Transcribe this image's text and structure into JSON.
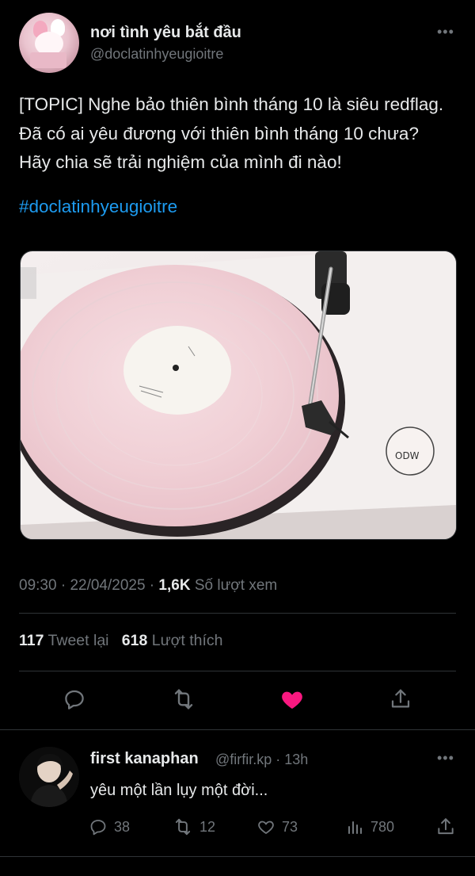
{
  "author": {
    "display_name": "nơi tình yêu bắt đầu",
    "handle": "@doclatinhyeugioitre"
  },
  "tweet": {
    "text": "[TOPIC] Nghe bảo thiên bình tháng 10 là siêu redflag. Đã có ai yêu đương với thiên bình tháng 10 chưa? Hãy chia sẽ trải nghiệm của mình đi nào!",
    "hashtag": "#doclatinhyeugioitre",
    "time": "09:30",
    "date": "22/04/2025",
    "views_count": "1,6K",
    "views_label": "Số lượt xem",
    "retweets_count": "117",
    "retweets_label": "Tweet lại",
    "likes_count": "618",
    "likes_label": "Lượt thích",
    "liked": true
  },
  "actions": [
    {
      "icon": "reply-icon"
    },
    {
      "icon": "retweet-icon"
    },
    {
      "icon": "heart-icon"
    },
    {
      "icon": "share-icon"
    }
  ],
  "reply": {
    "display_name": "first kanaphan",
    "handle": "@firfir.kp",
    "time": "13h",
    "text": "yêu một lần lụy một đời...",
    "replies": "38",
    "retweets": "12",
    "likes": "73",
    "views": "780"
  },
  "colors": {
    "background": "#000000",
    "text": "#e7e9ea",
    "secondary": "#71767b",
    "link": "#1d9bf0",
    "like": "#f91880",
    "divider": "#2f3336"
  }
}
